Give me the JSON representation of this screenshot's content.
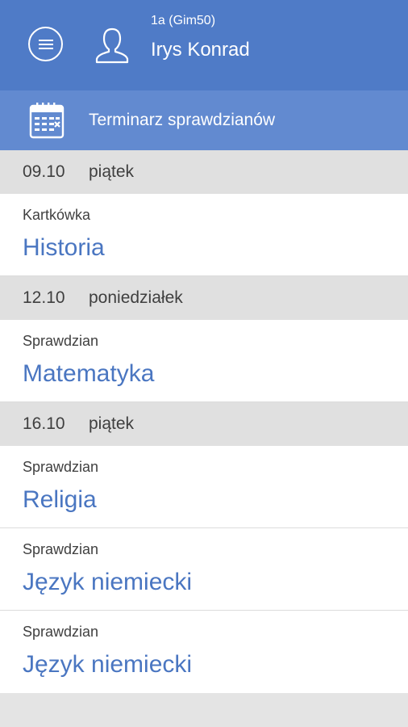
{
  "header": {
    "class_label": "1a (Gim50)",
    "user_name": "Irys Konrad",
    "icons": {
      "menu": "menu-icon",
      "user": "user-icon"
    }
  },
  "subheader": {
    "title": "Terminarz sprawdzianów",
    "icon": "calendar-icon"
  },
  "colors": {
    "header_bg": "#4f7bc7",
    "subheader_bg": "#628ad0",
    "subject_text": "#4a76c1",
    "date_bg": "#e0e0e0"
  },
  "days": [
    {
      "date": "09.10",
      "weekday": "piątek",
      "entries": [
        {
          "type": "Kartkówka",
          "subject": "Historia"
        }
      ]
    },
    {
      "date": "12.10",
      "weekday": "poniedziałek",
      "entries": [
        {
          "type": "Sprawdzian",
          "subject": "Matematyka"
        }
      ]
    },
    {
      "date": "16.10",
      "weekday": "piątek",
      "entries": [
        {
          "type": "Sprawdzian",
          "subject": "Religia"
        },
        {
          "type": "Sprawdzian",
          "subject": "Język niemiecki"
        },
        {
          "type": "Sprawdzian",
          "subject": "Język niemiecki"
        }
      ]
    }
  ]
}
